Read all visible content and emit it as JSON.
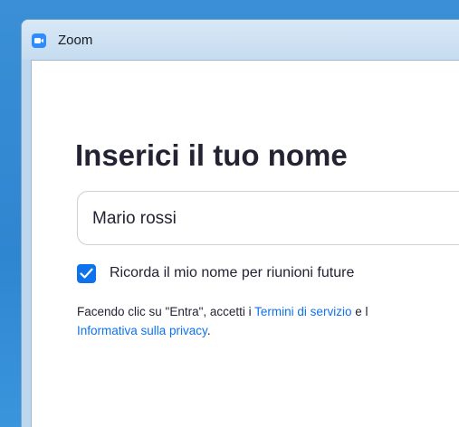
{
  "window": {
    "title": "Zoom",
    "icon": "zoom-app-icon"
  },
  "join": {
    "heading": "Inserici il tuo nome",
    "name_value": "Mario rossi",
    "remember": {
      "checked": true,
      "label": "Ricorda il mio nome per riunioni future"
    },
    "terms": {
      "prefix": "Facendo clic su \"Entra\", accetti i ",
      "terms_link": "Termini di servizio",
      "middle": " e l",
      "privacy_link": "Informativa sulla privacy",
      "suffix": "."
    }
  },
  "colors": {
    "accent": "#0e72ed",
    "desktop": "#2f86d0",
    "titlebar": "#c6dcf0",
    "text": "#232333"
  }
}
